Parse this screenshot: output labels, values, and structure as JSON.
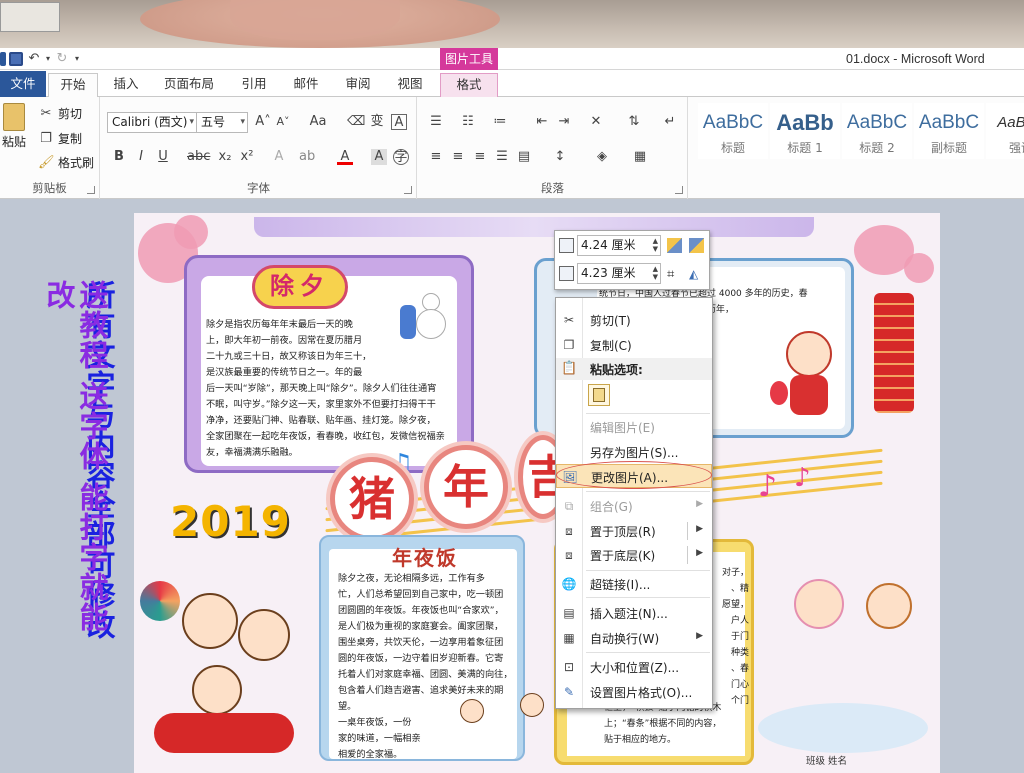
{
  "window": {
    "title": "01.docx - Microsoft Word"
  },
  "context_tab": {
    "header": "图片工具",
    "tab": "格式"
  },
  "tabs": [
    "文件",
    "开始",
    "插入",
    "页面布局",
    "引用",
    "邮件",
    "审阅",
    "视图"
  ],
  "clipboard": {
    "paste": "粘贴",
    "cut": "剪切",
    "copy": "复制",
    "format_painter": "格式刷",
    "group": "剪贴板"
  },
  "font": {
    "name": "Calibri (西文)",
    "size": "五号",
    "group": "字体",
    "change_case": "Aa"
  },
  "paragraph": {
    "group": "段落"
  },
  "styles": {
    "items": [
      {
        "sample": "AaBbC",
        "name": "标题"
      },
      {
        "sample": "AaBb",
        "name": "标题 1"
      },
      {
        "sample": "AaBbC",
        "name": "标题 2"
      },
      {
        "sample": "AaBbC",
        "name": "副标题"
      },
      {
        "sample": "AaBbC",
        "name": "强调"
      }
    ]
  },
  "side_text": {
    "col1": "所有文字与内容全部可修改",
    "col2": "送教程 送字体 能打字就能改"
  },
  "document": {
    "chuxi_title": "除夕",
    "chuxi_body": "除夕是指农历每年年末最后一天的晚\n上，即大年初一前夜。因常在夏历腊月\n二十九或三十日，故又称该日为年三十，\n是汉族最重要的传统节日之一。年的最\n后一天叫“岁除”，那天晚上叫“除夕”。除夕人们往往通宵\n不眠，叫守岁。”除夕这一天，家里家外不但要打扫得干干\n净净，还要贴门神、贴春联、贴年画、挂灯笼。除夕夜，\n全家团聚在一起吃年夜饭，看春晚，收红包，发微信祝福亲\n友，幸福满满乐融融。",
    "right_body": "的传\n统节日，中国人过春节已超过 4000 多年的历史，春\n就是一年的第一天，又叫阴历年，\n间的春节是指从腊月的",
    "year": "2019",
    "banner_chars": [
      "猪",
      "年",
      "吉"
    ],
    "nianyefan_title": "年夜饭",
    "nianyefan_body": "除夕之夜，无论相隔多远，工作有多\n忙，人们总希望回到自己家中，吃一顿团\n团圆圆的年夜饭。年夜饭也叫“合家欢”，\n是人们极为重视的家庭宴会。阖家团聚，\n围坐桌旁，共饮天伦，一边享用着象征团\n圆的年夜饭，一边守着旧岁迎新春。它寄\n托着人们对家庭幸福、团圆、美满的向往，\n包含着人们趋吉避害、追求美好未来的期\n望。\n一桌年夜饭，一份\n家的味道，一幅相亲\n相爱的全家福。",
    "br_body": "对子，\n、精\n愿望，\n户人\n于门\n种类\n、春\n门心\n个门",
    "br_body2": "框上，“横披”贴于门楣的横木\n上；“春条”根据不同的内容，\n贴于相应的地方。",
    "footer": "班级   姓名"
  },
  "size_toolbar": {
    "height": "4.24 厘米",
    "width": "4.23 厘米"
  },
  "context_menu": {
    "cut": "剪切(T)",
    "copy": "复制(C)",
    "paste_options": "粘贴选项:",
    "edit_picture": "编辑图片(E)",
    "save_as_picture": "另存为图片(S)...",
    "change_picture": "更改图片(A)...",
    "group": "组合(G)",
    "bring_front": "置于顶层(R)",
    "send_back": "置于底层(K)",
    "hyperlink": "超链接(I)...",
    "insert_caption": "插入题注(N)...",
    "text_wrap": "自动换行(W)",
    "size_position": "大小和位置(Z)...",
    "format_picture": "设置图片格式(O)..."
  },
  "colors": {
    "accent": "#2b579a",
    "context_tab": "#d5399b",
    "side_purple": "#8a2be2",
    "side_blue": "#1a22e0"
  }
}
